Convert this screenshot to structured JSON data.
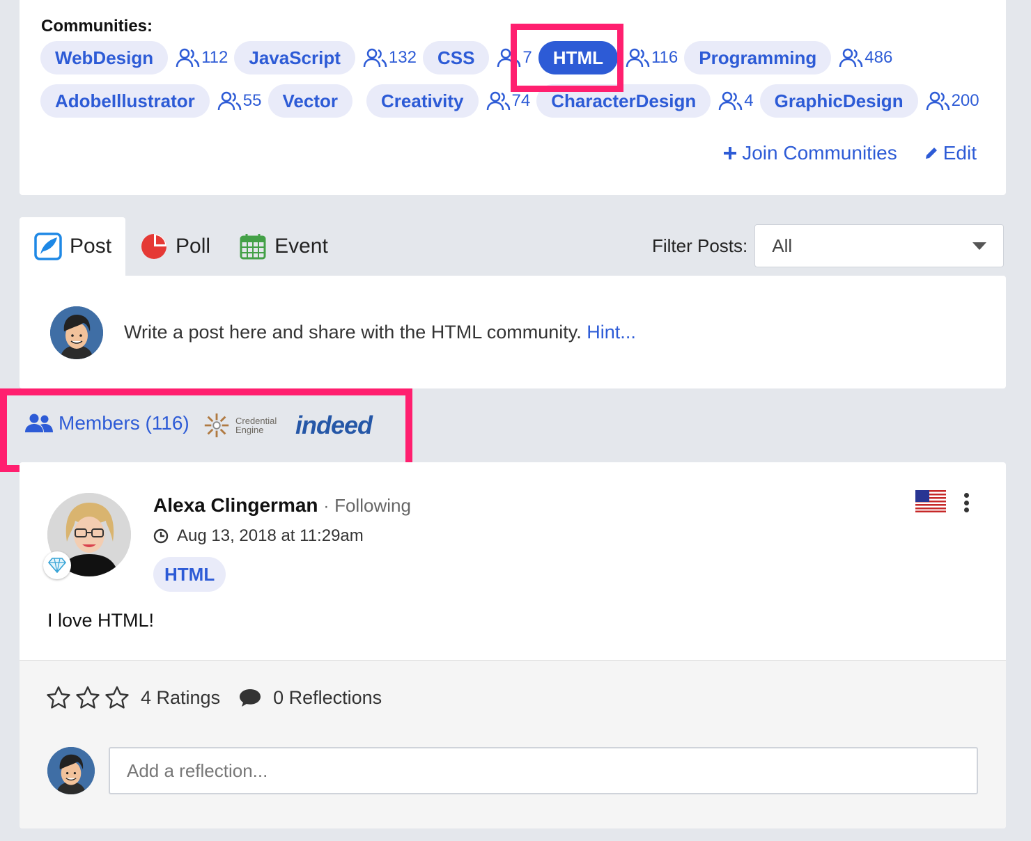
{
  "communities": {
    "label": "Communities:",
    "row1": [
      {
        "name": "WebDesign",
        "count": "112"
      },
      {
        "name": "JavaScript",
        "count": "132"
      },
      {
        "name": "CSS",
        "count": "7"
      },
      {
        "name": "HTML",
        "count": "116",
        "active": true
      },
      {
        "name": "Programming",
        "count": "486"
      }
    ],
    "row2": [
      {
        "name": "AdobeIllustrator",
        "count": "55"
      },
      {
        "name": "Vector",
        "count": ""
      },
      {
        "name": "Creativity",
        "count": "74"
      },
      {
        "name": "CharacterDesign",
        "count": "4"
      },
      {
        "name": "GraphicDesign",
        "count": "200"
      }
    ],
    "join_label": "Join Communities",
    "edit_label": "Edit"
  },
  "tabs": {
    "post": "Post",
    "poll": "Poll",
    "event": "Event"
  },
  "filter": {
    "label": "Filter Posts:",
    "value": "All"
  },
  "compose": {
    "prompt": "Write a post here and share with the HTML community.",
    "hint": "Hint..."
  },
  "members": {
    "label": "Members (116)",
    "partner1": "Credential Engine",
    "partner1_line1": "Credential",
    "partner1_line2": "Engine",
    "partner2": "indeed"
  },
  "post": {
    "author": "Alexa Clingerman",
    "separator": "·",
    "follow_status": "Following",
    "timestamp": "Aug 13, 2018 at 11:29am",
    "tag": "HTML",
    "body": "I love HTML!",
    "ratings": "4 Ratings",
    "reflections": "0 Reflections",
    "reflection_placeholder": "Add a reflection..."
  },
  "colors": {
    "accent": "#2d5bd6",
    "chip_bg": "#e9ebf9",
    "highlight": "#ff1f6f",
    "page_bg": "#e4e7ec"
  }
}
